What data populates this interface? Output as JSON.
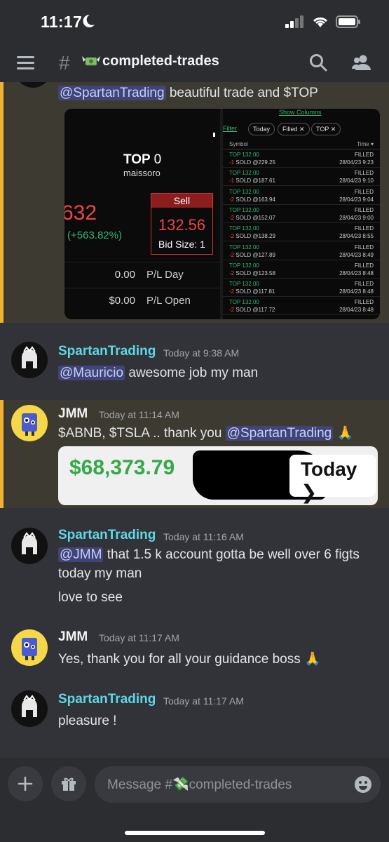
{
  "status_bar": {
    "time": "11:17"
  },
  "header": {
    "channel_name": "completed-trades"
  },
  "messages": [
    {
      "user": "",
      "mention": "@SpartanTrading",
      "text": " beautiful trade and $TOP",
      "screenshot": {
        "symbol": "TOP",
        "symbol_qty": "0",
        "sub": "maissoro",
        "price": "632",
        "change": "(+563.82%)",
        "sell_label": "Sell",
        "sell_price": "132.56",
        "bid_size": "Bid Size: 1",
        "pl_day_value": "0.00",
        "pl_day_label": "P/L Day",
        "pl_open_value": "$0.00",
        "pl_open_label": "P/L Open",
        "show_columns": "Show Columns",
        "filter": "Filter",
        "chips": [
          "Today",
          "Filled",
          "TOP"
        ],
        "col_symbol": "Symbol",
        "col_time": "Time",
        "orders": [
          {
            "sym": "TOP",
            "price": "132.00",
            "qty": "-1",
            "sold": "SOLD @229.25",
            "status": "FILLED",
            "time": "28/04/23 9:23"
          },
          {
            "sym": "TOP",
            "price": "132.00",
            "qty": "-1",
            "sold": "SOLD @187.61",
            "status": "FILLED",
            "time": "28/04/23 9:10"
          },
          {
            "sym": "TOP",
            "price": "132.00",
            "qty": "-2",
            "sold": "SOLD @163.94",
            "status": "FILLED",
            "time": "28/04/23 9:04"
          },
          {
            "sym": "TOP",
            "price": "132.00",
            "qty": "-2",
            "sold": "SOLD @152.07",
            "status": "FILLED",
            "time": "28/04/23 9:00"
          },
          {
            "sym": "TOP",
            "price": "132.00",
            "qty": "-2",
            "sold": "SOLD @138.29",
            "status": "FILLED",
            "time": "28/04/23 8:55"
          },
          {
            "sym": "TOP",
            "price": "132.00",
            "qty": "-2",
            "sold": "SOLD @127.89",
            "status": "FILLED",
            "time": "28/04/23 8:49"
          },
          {
            "sym": "TOP",
            "price": "132.00",
            "qty": "-2",
            "sold": "SOLD @123.58",
            "status": "FILLED",
            "time": "28/04/23 8:48"
          },
          {
            "sym": "TOP",
            "price": "132.00",
            "qty": "-2",
            "sold": "SOLD @117.81",
            "status": "FILLED",
            "time": "28/04/23 8:48"
          },
          {
            "sym": "TOP",
            "price": "132.00",
            "qty": "-2",
            "sold": "SOLD @117.72",
            "status": "FILLED",
            "time": "28/04/23 8:48"
          }
        ]
      }
    },
    {
      "user": "SpartanTrading",
      "time": "Today at 9:38 AM",
      "mention": "@Mauricio",
      "text": " awesome job my man"
    },
    {
      "user": "JMM",
      "time": "Today at 11:14 AM",
      "text_before": "$ABNB, $TSLA .. thank you ",
      "mention": "@SpartanTrading",
      "text_after": " 🙏",
      "screenshot": {
        "amount": "$68,373.79",
        "button": "Today"
      }
    },
    {
      "user": "SpartanTrading",
      "time": "Today at 11:16 AM",
      "mention": "@JMM",
      "text": " that 1.5 k account gotta be well over 6 figts today my man",
      "text2": "love to see"
    },
    {
      "user": "JMM",
      "time": "Today at 11:17 AM",
      "text": "Yes, thank you for all your guidance boss 🙏"
    },
    {
      "user": "SpartanTrading",
      "time": "Today at 11:17 AM",
      "text": "pleasure !"
    }
  ],
  "composer": {
    "placeholder": "Message #💸completed-trades"
  },
  "colors": {
    "mention_bg": "#3f4577",
    "highlight_bar": "#f0b232",
    "user_spartan": "#5fd7e6",
    "gain_green": "#35a94a"
  }
}
